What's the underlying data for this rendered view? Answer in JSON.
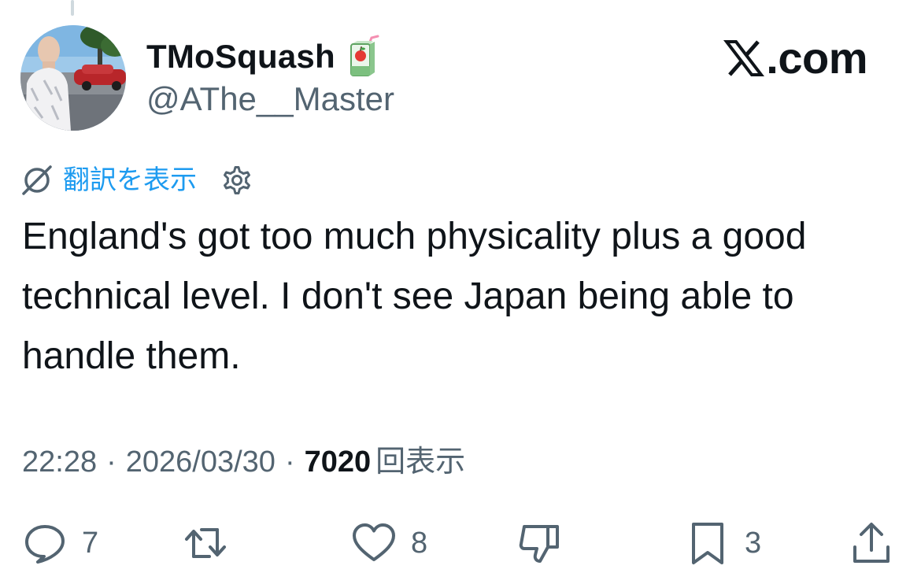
{
  "author": {
    "display_name": "TMoSquash",
    "handle": "@AThe__Master",
    "badge_icon": "juice-box-icon"
  },
  "brand": {
    "text": ".com",
    "icon": "x-logo-icon"
  },
  "translate": {
    "label": "翻訳を表示",
    "icon": "no-translate-icon",
    "settings_icon": "gear-icon",
    "color": "#1d9bf0"
  },
  "tweet": {
    "text": "England's got too much physicality plus a good technical level. I don't see Japan being able to handle them."
  },
  "meta": {
    "time": "22:28",
    "separator": "·",
    "date": "2026/03/30",
    "views_count": "7020",
    "views_label": "回表示"
  },
  "actions": {
    "reply": {
      "icon": "reply-icon",
      "count": "7"
    },
    "retweet": {
      "icon": "retweet-icon",
      "count": ""
    },
    "like": {
      "icon": "heart-icon",
      "count": "8"
    },
    "dislike": {
      "icon": "dislike-icon",
      "count": ""
    },
    "bookmark": {
      "icon": "bookmark-icon",
      "count": "3"
    },
    "share": {
      "icon": "share-icon",
      "count": ""
    }
  },
  "colors": {
    "text_primary": "#0f1419",
    "text_secondary": "#536471",
    "accent": "#1d9bf0",
    "background": "#ffffff"
  }
}
